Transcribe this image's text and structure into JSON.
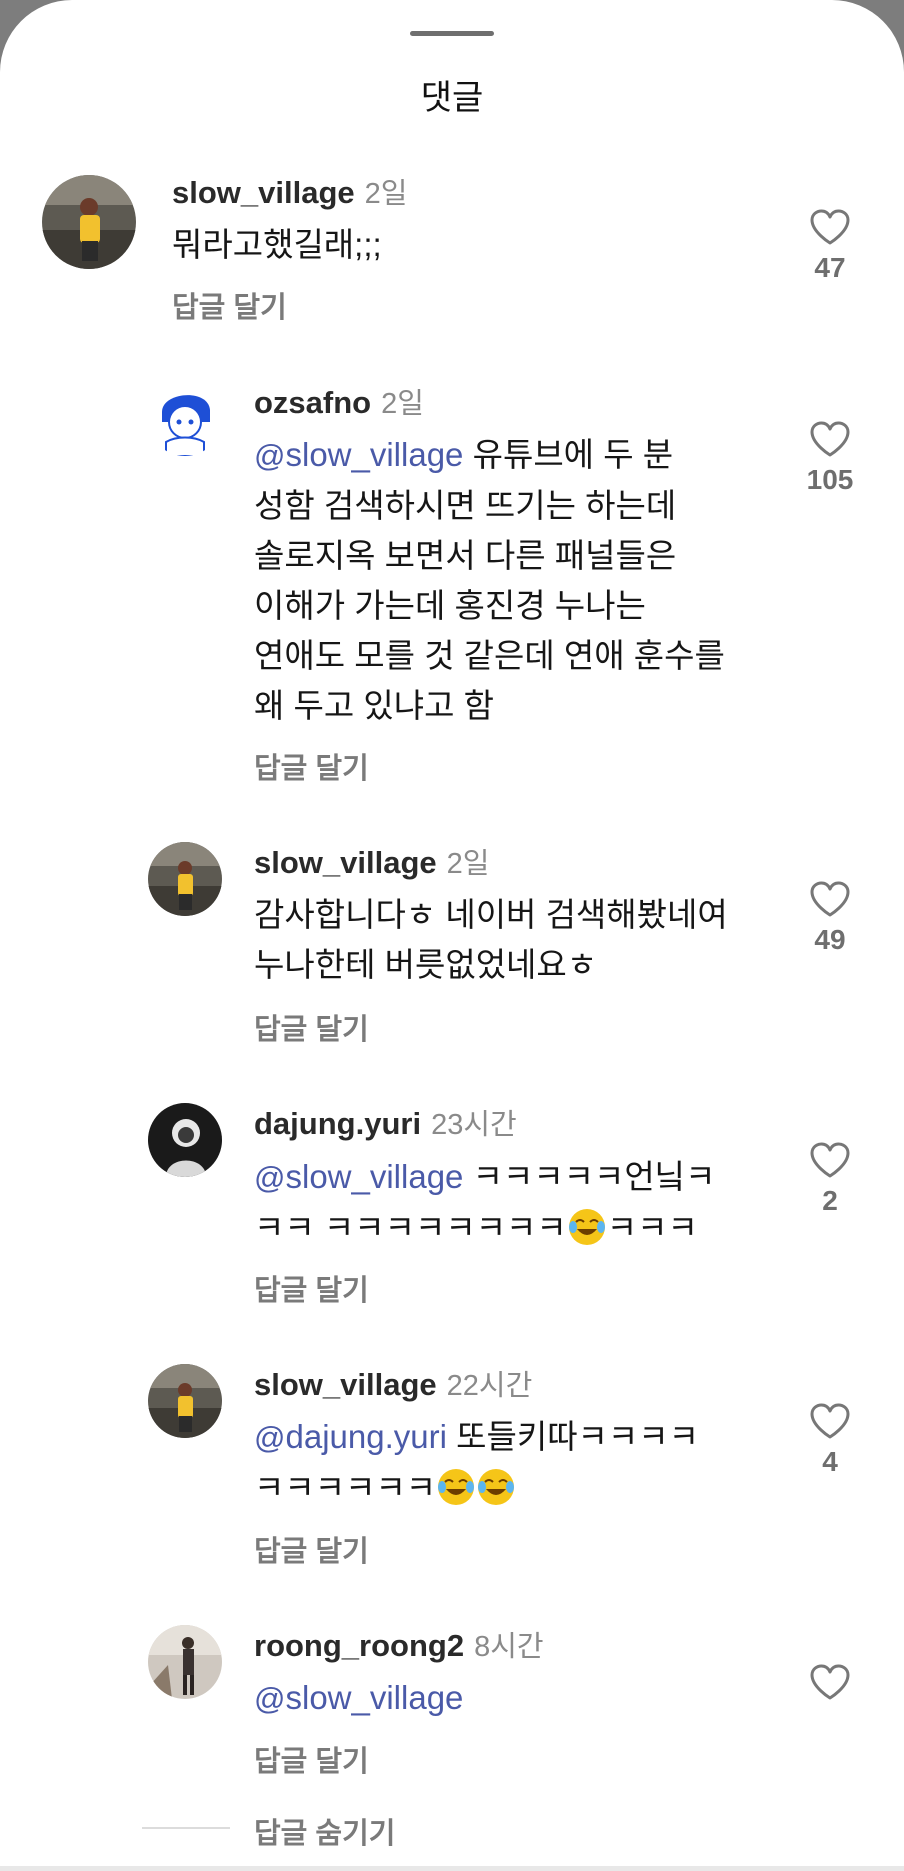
{
  "sheet": {
    "title": "댓글"
  },
  "comments": [
    {
      "username": "slow_village",
      "time": "2일",
      "mention": "",
      "text_lines": [
        "뭐라고했길래;;;"
      ],
      "reply_label": "답글 달기",
      "likes": "47"
    },
    {
      "username": "ozsafno",
      "time": "2일",
      "mention": "slow_village",
      "text_lines": [
        "유튜브에 두 분",
        "성함 검색하시면 뜨기는 하는데",
        "솔로지옥 보면서 다른 패널들은",
        "이해가 가는데 홍진경 누나는",
        "연애도 모를 것 같은데 연애 훈수를",
        "왜 두고 있냐고 함"
      ],
      "reply_label": "답글 달기",
      "likes": "105"
    },
    {
      "username": "slow_village",
      "time": "2일",
      "mention": "",
      "text_lines": [
        "감사합니다ㅎ 네이버 검색해봤네여",
        "누나한테 버릇없었네요ㅎ"
      ],
      "reply_label": "답글 달기",
      "likes": "49"
    },
    {
      "username": "dajung.yuri",
      "time": "23시간",
      "mention": "slow_village",
      "text_lines": [
        "ㅋㅋㅋㅋㅋ언닠ㅋ",
        "ㅋㅋ ㅋㅋㅋㅋㅋㅋㅋㅋ",
        "ㅋㅋㅋ"
      ],
      "reply_label": "답글 달기",
      "likes": "2"
    },
    {
      "username": "slow_village",
      "time": "22시간",
      "mention": "dajung.yuri",
      "text_lines": [
        "또들키따ㅋㅋㅋㅋ",
        "ㅋㅋㅋㅋㅋㅋ"
      ],
      "reply_label": "답글 달기",
      "likes": "4"
    },
    {
      "username": "roong_roong2",
      "time": "8시간",
      "mention": "slow_village",
      "text_lines": [],
      "reply_label": "답글 달기",
      "likes": ""
    }
  ],
  "hide_replies_label": "답글 숨기기",
  "icons": {
    "like": "heart-outline-icon",
    "mention": "threads-at-icon",
    "emoji": "face-with-tears-of-joy-icon"
  },
  "colors": {
    "mention": "#4a5aa8",
    "meta": "#8a8a8a",
    "background": "#ffffff"
  }
}
